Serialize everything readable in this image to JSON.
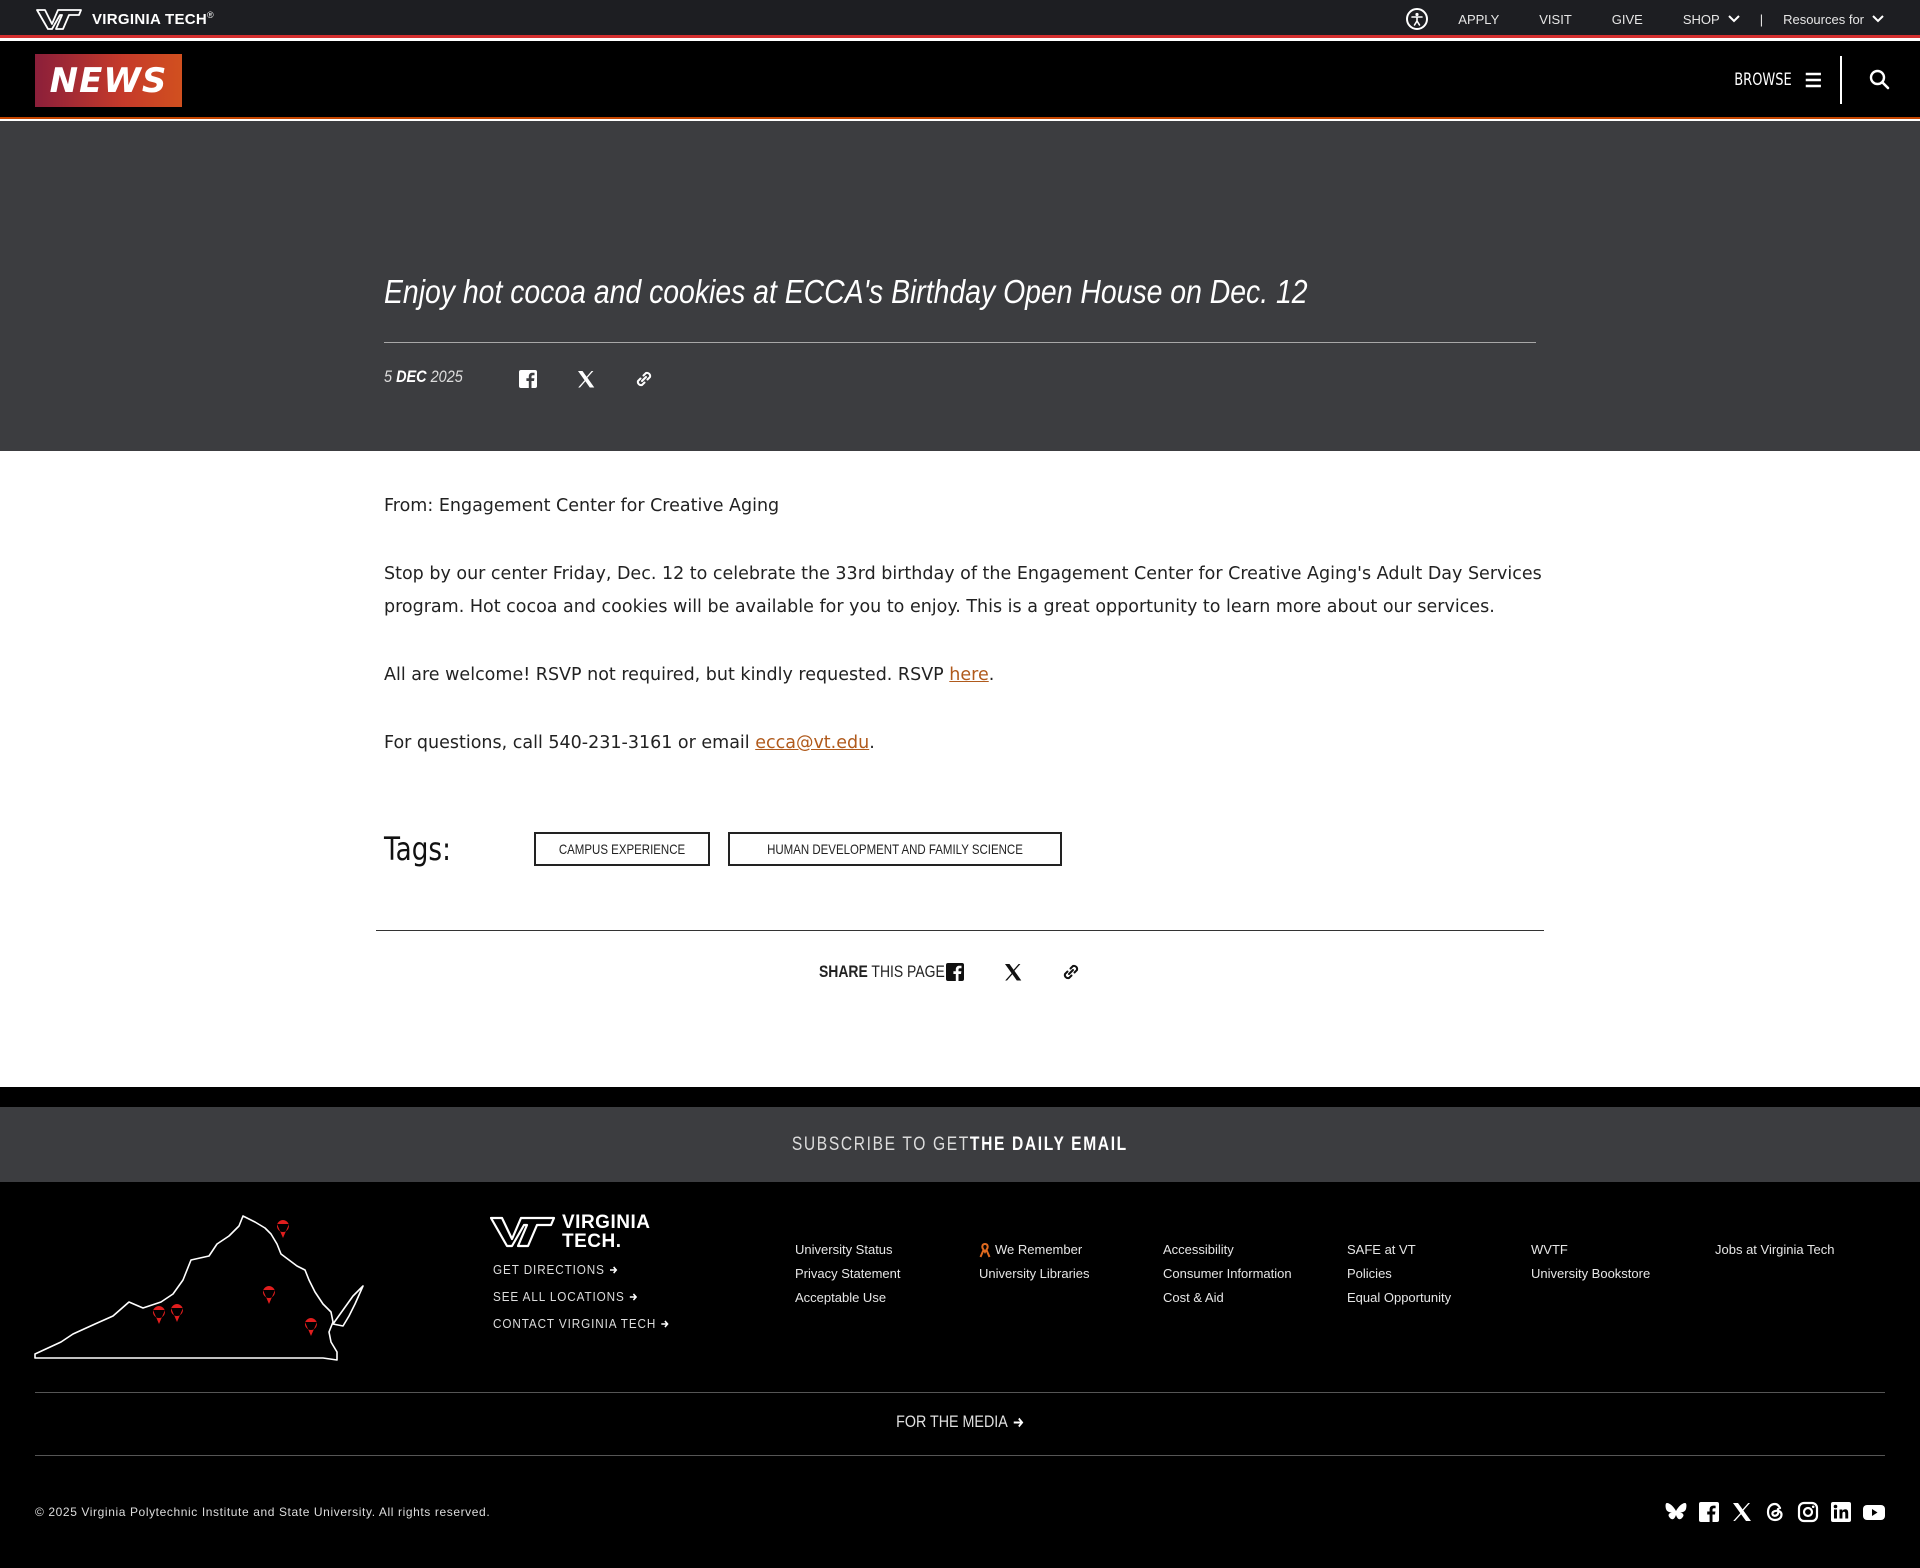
{
  "utility": {
    "brand": "VIRGINIA TECH",
    "brand_reg": "®",
    "nav": [
      {
        "label": "APPLY"
      },
      {
        "label": "VISIT"
      },
      {
        "label": "GIVE"
      },
      {
        "label": "SHOP"
      },
      {
        "label": "Resources for"
      }
    ],
    "separator": "|"
  },
  "header": {
    "logo": "NEWS",
    "browse": "BROWSE"
  },
  "article": {
    "title": "Enjoy hot cocoa and cookies at ECCA's Birthday Open House on Dec. 12",
    "date_day": "5",
    "date_month": "DEC",
    "date_year": "2025",
    "from": "From: Engagement Center for Creative Aging",
    "para1": "Stop by our center Friday, Dec. 12 to celebrate the 33rd birthday of the Engagement Center for Creative Aging's Adult Day Services program. Hot cocoa and cookies will be available for you to enjoy. This is a great opportunity to learn more about our services.",
    "para2_pre": "All are welcome! RSVP not required, but kindly requested. RSVP ",
    "para2_link": "here",
    "para2_post": ".",
    "para3_pre": "For questions, call 540-231-3161 or email ",
    "para3_link": "ecca@vt.edu",
    "para3_post": "."
  },
  "tags": {
    "label": "Tags:",
    "items": [
      "CAMPUS EXPERIENCE",
      "HUMAN DEVELOPMENT AND FAMILY SCIENCE"
    ]
  },
  "share": {
    "bold": "SHARE",
    "rest": "THIS PAGE"
  },
  "subscribe": {
    "pre": "SUBSCRIBE TO GET",
    "bold": "THE DAILY EMAIL"
  },
  "footer": {
    "brand_line1": "VIRGINIA",
    "brand_line2": "TECH.",
    "left_links": [
      "GET DIRECTIONS",
      "SEE ALL LOCATIONS",
      "CONTACT VIRGINIA TECH"
    ],
    "columns": [
      [
        "University Status",
        "Privacy Statement",
        "Acceptable Use"
      ],
      [
        "We Remember",
        "University Libraries"
      ],
      [
        "Accessibility",
        "Consumer Information",
        "Cost & Aid"
      ],
      [
        "SAFE at VT",
        "Policies",
        "Equal Opportunity"
      ],
      [
        "WVTF",
        "University Bookstore"
      ],
      [
        "Jobs at Virginia Tech"
      ]
    ],
    "media": "FOR THE MEDIA",
    "copyright": "© 2025 Virginia Polytechnic Institute and State University. All rights reserved.",
    "social": [
      "bluesky-icon",
      "facebook-icon",
      "x-icon",
      "threads-icon",
      "instagram-icon",
      "linkedin-icon",
      "youtube-icon"
    ]
  },
  "colors": {
    "accent_red": "#d42f2f",
    "link_orange": "#b05a1c",
    "hero_bg": "#3c3d40"
  }
}
